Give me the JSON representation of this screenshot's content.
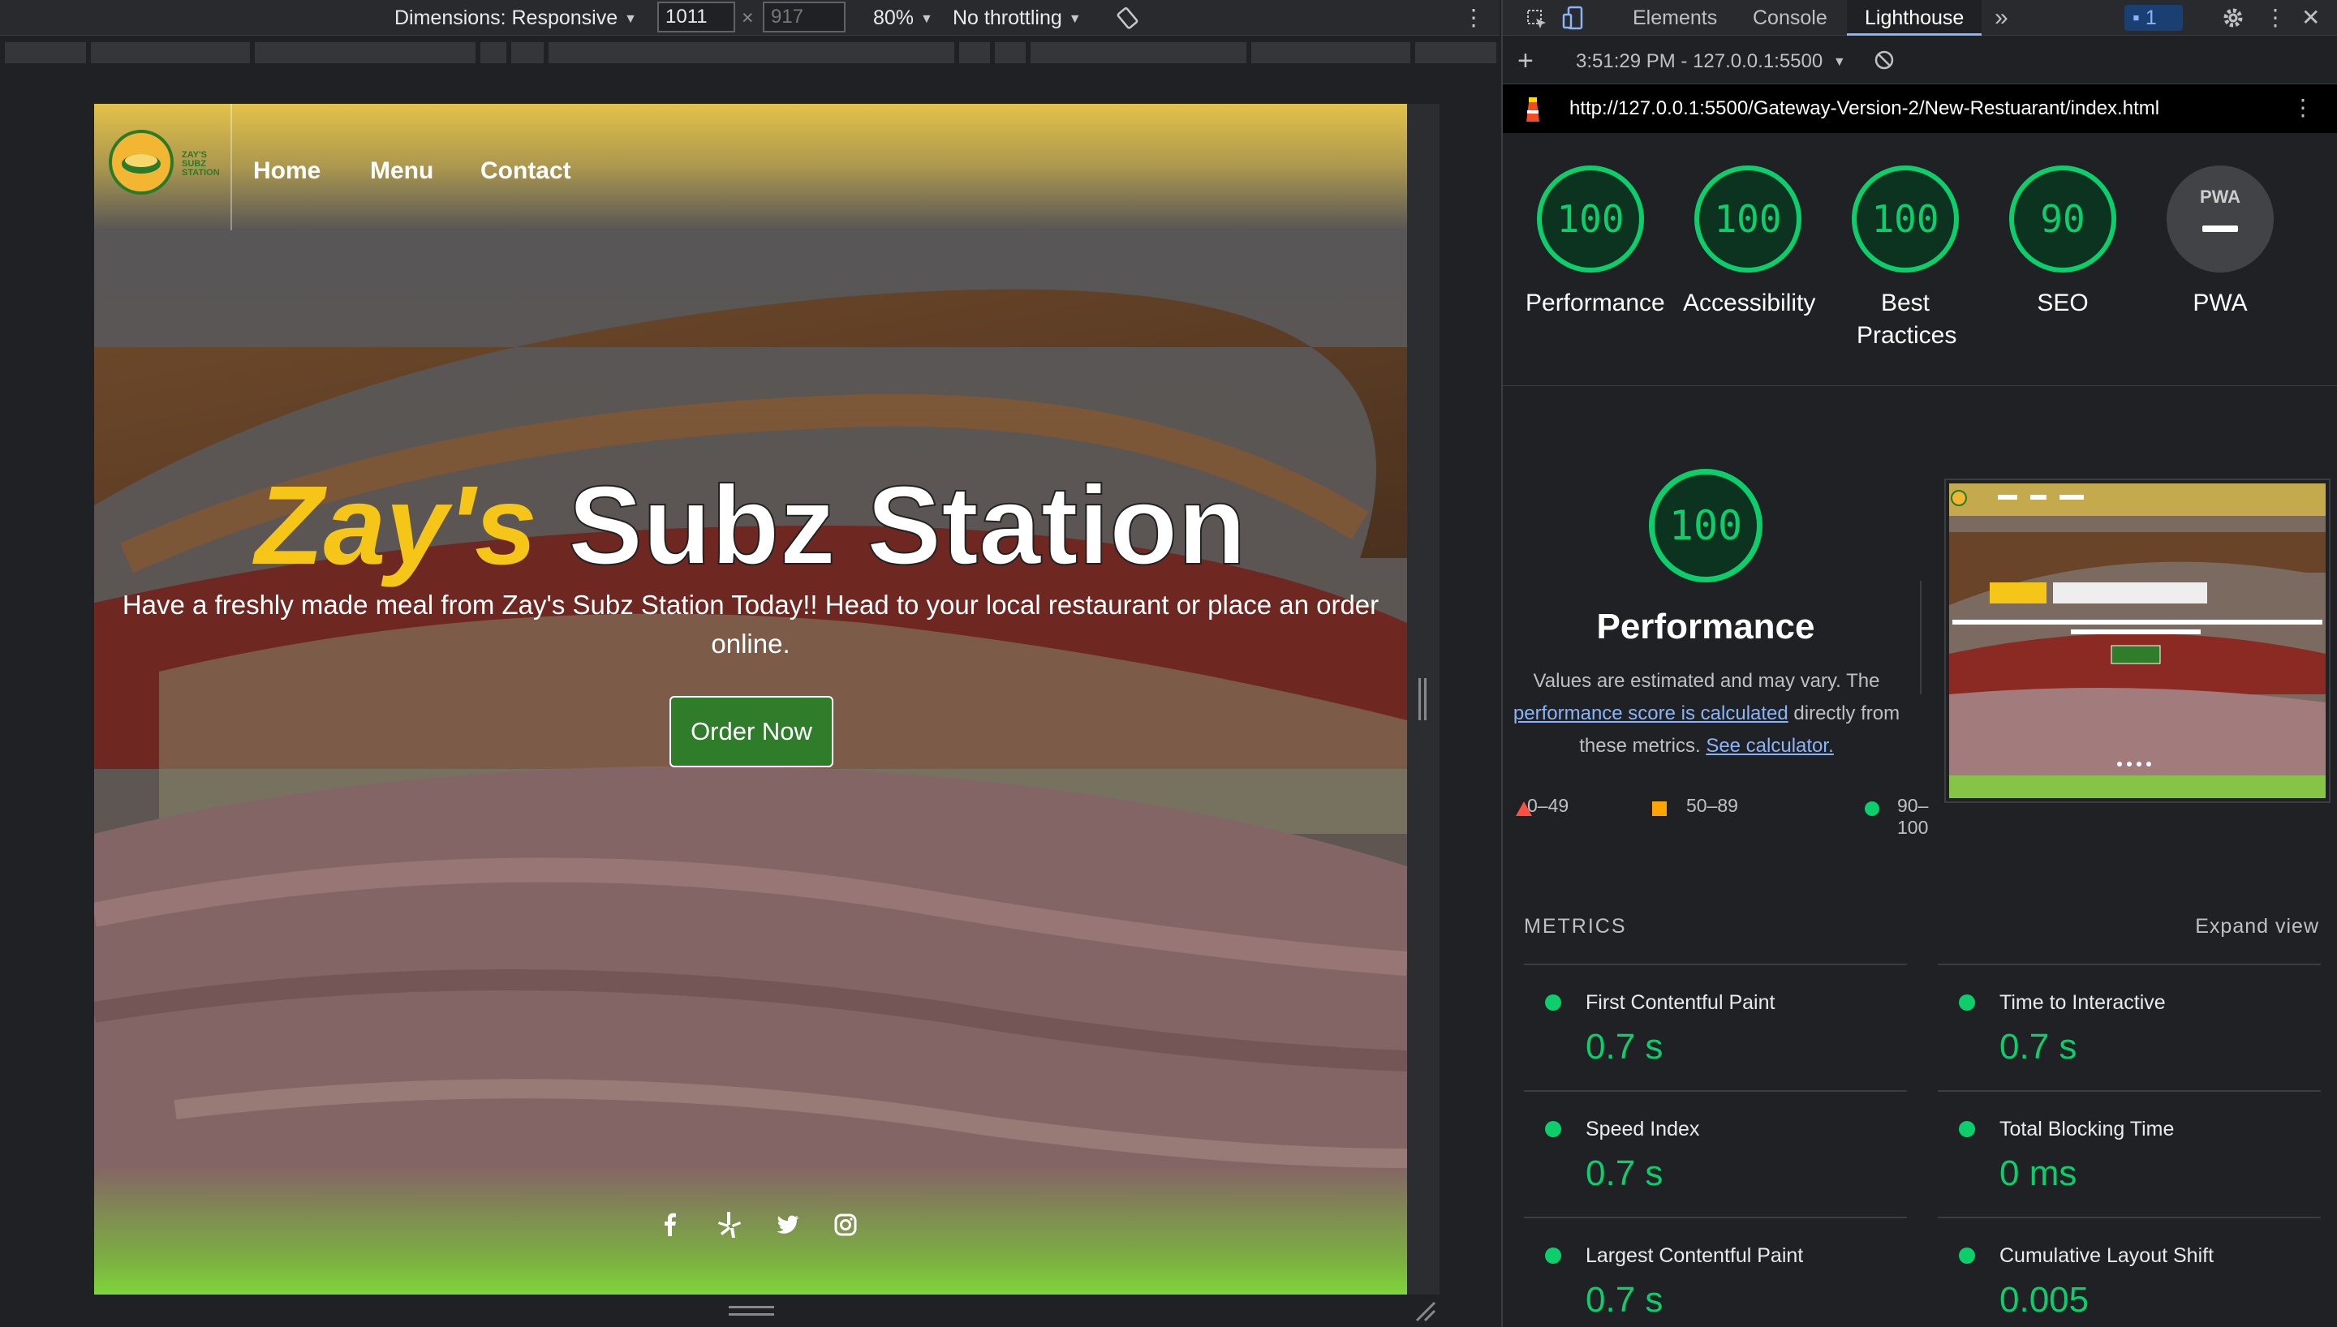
{
  "emulation_toolbar": {
    "dimensions_label": "Dimensions: Responsive",
    "width_value": "1011",
    "height_placeholder": "917",
    "times": "×",
    "zoom": "80%",
    "throttling": "No throttling"
  },
  "site": {
    "logo_text": "ZAY'S SUBZ STATION",
    "nav": [
      "Home",
      "Menu",
      "Contact"
    ],
    "hero_title_part1": "Zay's",
    "hero_title_part2": "Subz Station",
    "hero_subtitle": "Have a freshly made meal from Zay's Subz Station Today!! Head to your local restaurant or place an order online.",
    "order_button": "Order Now",
    "socials": [
      "facebook-icon",
      "yelp-icon",
      "twitter-icon",
      "instagram-icon"
    ]
  },
  "devtools": {
    "tabs": [
      "Elements",
      "Console",
      "Lighthouse"
    ],
    "more_tabs": "»",
    "issues_count": "1",
    "report_selector": "3:51:29 PM - 127.0.0.1:5500",
    "url": "http://127.0.0.1:5500/Gateway-Version-2/New-Restuarant/index.html",
    "gauges": [
      {
        "score": "100",
        "label": "Performance"
      },
      {
        "score": "100",
        "label": "Accessibility"
      },
      {
        "score": "100",
        "label": "Best Practices"
      },
      {
        "score": "90",
        "label": "SEO"
      },
      {
        "score": "PWA",
        "label": "PWA"
      }
    ],
    "performance": {
      "score": "100",
      "title": "Performance",
      "note_text1": "Values are estimated and may vary. The",
      "note_link1": "performance score is calculated",
      "note_text2": "directly from these metrics.",
      "note_link2": "See calculator."
    },
    "legend": [
      "0–49",
      "50–89",
      "90–100"
    ],
    "metrics_header": "METRICS",
    "expand_view": "Expand view",
    "metrics": [
      {
        "label": "First Contentful Paint",
        "value": "0.7 s"
      },
      {
        "label": "Time to Interactive",
        "value": "0.7 s"
      },
      {
        "label": "Speed Index",
        "value": "0.7 s"
      },
      {
        "label": "Total Blocking Time",
        "value": "0 ms"
      },
      {
        "label": "Largest Contentful Paint",
        "value": "0.7 s"
      },
      {
        "label": "Cumulative Layout Shift",
        "value": "0.005"
      }
    ],
    "colors": {
      "pass": "#0cce6b",
      "average": "#ffa400",
      "fail": "#ff4e42",
      "link": "#8ab4f8"
    }
  }
}
